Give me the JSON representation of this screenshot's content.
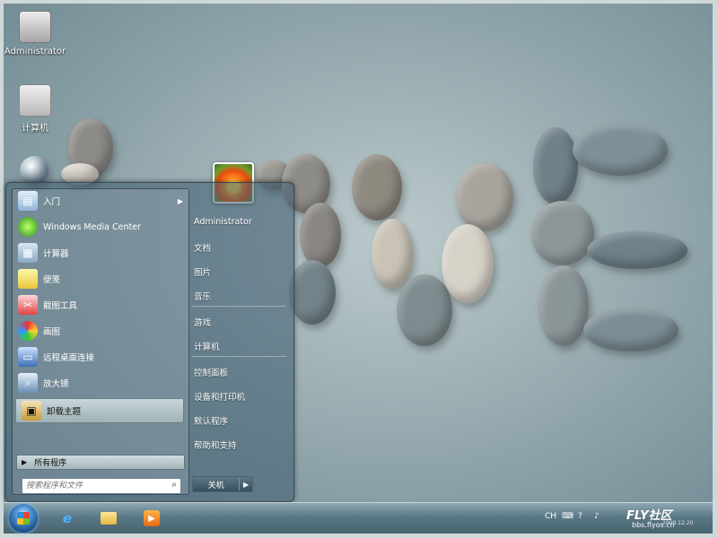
{
  "desktop": {
    "icons": [
      {
        "label": "Administrator",
        "icon": "user-folder-icon"
      },
      {
        "label": "计算机",
        "icon": "computer-icon"
      }
    ]
  },
  "start_menu": {
    "programs": [
      {
        "label": "入门",
        "icon": "getting-started-icon",
        "has_submenu": true
      },
      {
        "label": "Windows Media Center",
        "icon": "media-center-icon",
        "has_submenu": false
      },
      {
        "label": "计算器",
        "icon": "calculator-icon",
        "has_submenu": false
      },
      {
        "label": "便笺",
        "icon": "sticky-notes-icon",
        "has_submenu": false
      },
      {
        "label": "截图工具",
        "icon": "snipping-tool-icon",
        "has_submenu": false
      },
      {
        "label": "画图",
        "icon": "paint-icon",
        "has_submenu": false
      },
      {
        "label": "远程桌面连接",
        "icon": "remote-desktop-icon",
        "has_submenu": false
      },
      {
        "label": "放大镜",
        "icon": "magnifier-icon",
        "has_submenu": false
      },
      {
        "label": "卸载主题",
        "icon": "uninstall-theme-icon",
        "has_submenu": false,
        "highlighted": true
      }
    ],
    "all_programs_label": "所有程序",
    "search_placeholder": "搜索程序和文件",
    "right_items": [
      "Administrator",
      "文档",
      "图片",
      "音乐",
      "游戏",
      "计算机",
      "控制面板",
      "设备和打印机",
      "默认程序",
      "帮助和支持"
    ],
    "shutdown_label": "关机"
  },
  "taskbar": {
    "pinned": [
      "internet-explorer-icon",
      "explorer-folder-icon",
      "media-player-icon"
    ],
    "language": "CH"
  },
  "watermark": {
    "brand": "FLY社区",
    "url": "bbs.flyos.cn",
    "date": "2009.12.20"
  }
}
